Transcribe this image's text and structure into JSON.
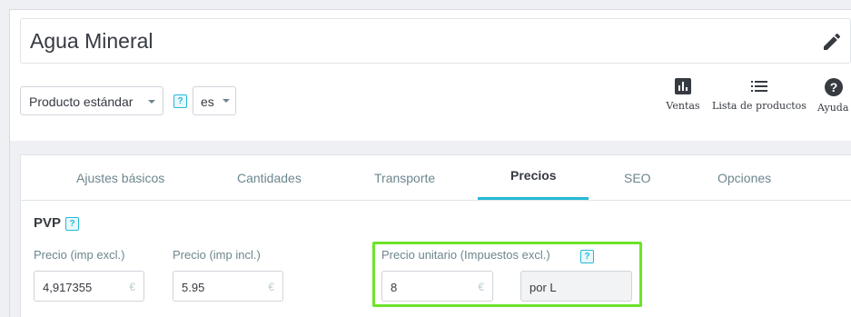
{
  "product": {
    "name": "Agua Mineral"
  },
  "type_select": {
    "value": "Producto estándar"
  },
  "language_select": {
    "value": "es"
  },
  "help_badge": "?",
  "toolbar": [
    {
      "label": "Ventas",
      "icon": "bar-chart-icon"
    },
    {
      "label": "Lista de productos",
      "icon": "list-icon"
    },
    {
      "label": "Ayuda",
      "icon": "help-circle-icon"
    }
  ],
  "tabs": [
    {
      "label": "Ajustes básicos",
      "active": false
    },
    {
      "label": "Cantidades",
      "active": false
    },
    {
      "label": "Transporte",
      "active": false
    },
    {
      "label": "Precios",
      "active": true
    },
    {
      "label": "SEO",
      "active": false
    },
    {
      "label": "Opciones",
      "active": false
    }
  ],
  "pricing": {
    "section_title": "PVP",
    "price_excl": {
      "label": "Precio (imp excl.)",
      "value": "4,917355",
      "unit": "€"
    },
    "price_incl": {
      "label": "Precio (imp incl.)",
      "value": "5.95",
      "unit": "€"
    },
    "unit_price": {
      "label": "Precio unitario (Impuestos excl.)",
      "value": "8",
      "unit": "€",
      "per": "por L"
    }
  },
  "colors": {
    "accent": "#25b9d7",
    "highlight": "#6de32b"
  }
}
